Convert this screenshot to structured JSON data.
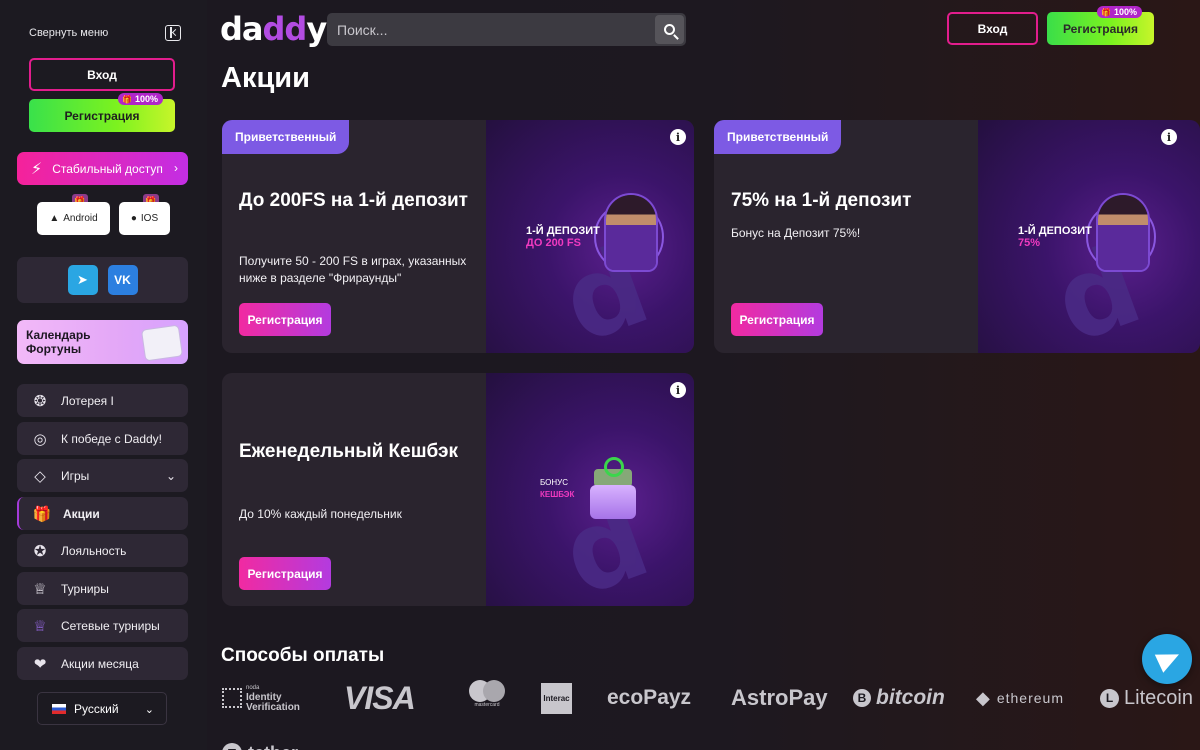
{
  "sidebar": {
    "collapse_label": "Свернуть меню",
    "login_label": "Вход",
    "register_label": "Регистрация",
    "register_badge": "100%",
    "stable_access_label": "Стабильный доступ",
    "apps": [
      {
        "label": "Android"
      },
      {
        "label": "IOS"
      }
    ],
    "social": [
      {
        "icon": "telegram-icon"
      },
      {
        "icon": "vk-icon",
        "text": "VK"
      }
    ],
    "fortune_label": "Календарь Фортуны",
    "menu": [
      {
        "label": "Лотерея I",
        "icon": "lottery-ball-icon"
      },
      {
        "label": "К победе с Daddy!",
        "icon": "target-icon"
      },
      {
        "label": "Игры",
        "icon": "diamond-icon"
      },
      {
        "label": "Акции",
        "icon": "gift-icon"
      },
      {
        "label": "Лояльность",
        "icon": "medal-icon"
      },
      {
        "label": "Турниры",
        "icon": "trophy-icon"
      },
      {
        "label": "Сетевые турниры",
        "icon": "trophy-network-icon"
      },
      {
        "label": "Акции месяца",
        "icon": "hand-gift-icon"
      }
    ],
    "language": "Русский"
  },
  "header": {
    "logo_left": "da",
    "logo_mid": "dd",
    "logo_right": "y",
    "search_placeholder": "Поиск...",
    "login_label": "Вход",
    "register_label": "Регистрация",
    "register_badge": "100%"
  },
  "page_title": "Акции",
  "promos": [
    {
      "tag": "Приветственный",
      "title": "До 200FS на 1-й депозит",
      "description": "Получите 50 - 200 FS в играх, указанных ниже в разделе \"Фрираунды\"",
      "button": "Регистрация",
      "art_line1": "1-Й ДЕПОЗИТ",
      "art_line2": "ДО 200 FS"
    },
    {
      "tag": "Приветственный",
      "title": "75% на 1-й депозит",
      "description": "Бонус на Депозит 75%!",
      "button": "Регистрация",
      "art_line1": "1-Й ДЕПОЗИТ",
      "art_line2": "75%"
    },
    {
      "tag": "",
      "title": "Еженедельный Кешбэк",
      "description": "До 10% каждый понедельник",
      "button": "Регистрация",
      "art_line1": "БОНУС",
      "art_line2": "КЕШБЭК"
    }
  ],
  "payments": {
    "title": "Способы оплаты",
    "logos": {
      "noda_small": "noda",
      "noda_line1": "Identity",
      "noda_line2": "Verification",
      "visa": "VISA",
      "mastercard": "mastercard",
      "interac": "Interac",
      "ecopayz": "ecoPayz",
      "astropay": "AstroPay",
      "bitcoin": "bitcoin",
      "ethereum": "ethereum",
      "litecoin": "Litecoin",
      "tether": "tether"
    }
  },
  "colors": {
    "accent_pink": "#e21d8d",
    "accent_purple": "#7d5ae4",
    "register_green": "#7cf21f",
    "telegram_blue": "#2aa6e3"
  }
}
